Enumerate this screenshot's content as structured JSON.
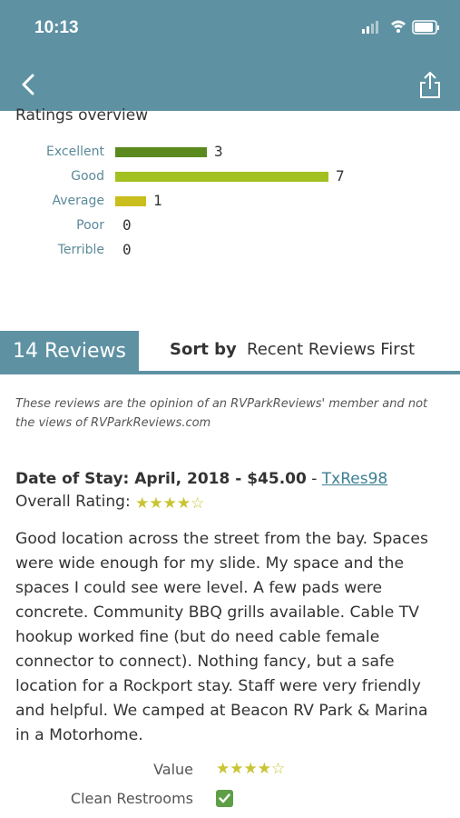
{
  "status": {
    "time": "10:13"
  },
  "nav": {
    "back_icon": "chevron-left-icon",
    "share_icon": "share-icon"
  },
  "overview": {
    "title": "Ratings overview",
    "rows": [
      {
        "label": "Excellent",
        "count": "3",
        "value": 3,
        "color": "#5a8a1e"
      },
      {
        "label": "Good",
        "count": "7",
        "value": 7,
        "color": "#a3c021"
      },
      {
        "label": "Average",
        "count": "1",
        "value": 1,
        "color": "#c9be1c"
      },
      {
        "label": "Poor",
        "count": "0",
        "value": 0,
        "color": "#cccccc"
      },
      {
        "label": "Terrible",
        "count": "0",
        "value": 0,
        "color": "#cccccc"
      }
    ]
  },
  "tabs": {
    "reviews_label": "14 Reviews",
    "sort_by_label": "Sort by",
    "sort_value": "Recent Reviews First"
  },
  "disclaimer": "These reviews are the opinion of an RVParkReviews' member and not the views of RVParkReviews.com",
  "review": {
    "date_label": "Date of Stay: April, 2018 - $45.00",
    "separator": " - ",
    "author": "TxRes98",
    "overall_label": "Overall Rating:",
    "overall_stars": "★★★★☆",
    "overall_rating": 4,
    "body": "Good location across the street from the bay. Spaces were wide enough for my slide. My space and the spaces I could see were level. A few pads were concrete. Community BBQ grills available. Cable TV hookup worked fine (but do need cable female connector to connect). Nothing fancy, but a safe location for a Rockport stay. Staff were very friendly and helpful. We camped at Beacon RV Park & Marina in a Motorhome.",
    "sub_ratings": [
      {
        "label": "Value",
        "stars": "★★★★☆",
        "rating": 4
      },
      {
        "label": "Clean Restrooms",
        "checked": true
      }
    ]
  },
  "colors": {
    "accent": "#5e92a3",
    "star": "#c9c431",
    "link": "#3b7f92",
    "check": "#5e9e47"
  }
}
